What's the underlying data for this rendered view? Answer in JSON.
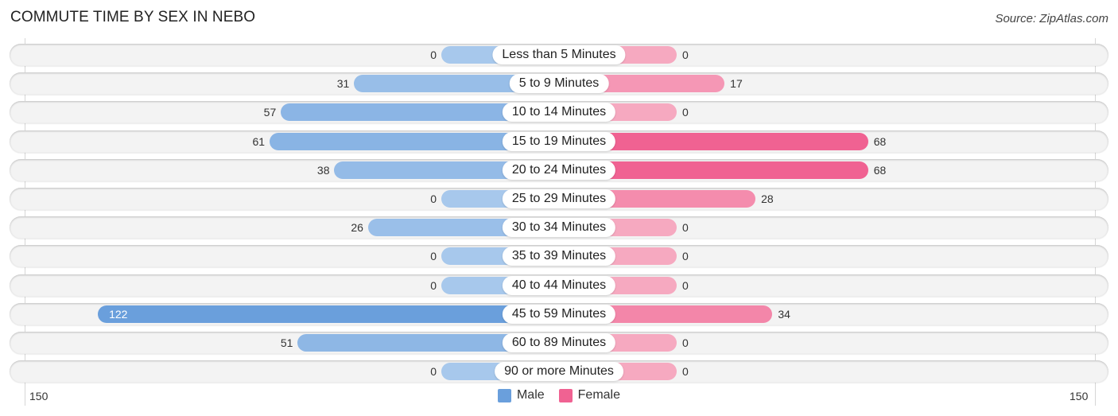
{
  "title": "COMMUTE TIME BY SEX IN NEBO",
  "source": "Source: ZipAtlas.com",
  "colors": {
    "male": "#6a9fdc",
    "male_light": "#a7c8ec",
    "female": "#f06292",
    "female_light": "#f6a9c0"
  },
  "legend": [
    {
      "label": "Male",
      "color": "#6a9fdc"
    },
    {
      "label": "Female",
      "color": "#f06292"
    }
  ],
  "axis": {
    "left_label": "150",
    "right_label": "150"
  },
  "chart_data": {
    "type": "bar",
    "orientation": "horizontal-diverging",
    "title": "COMMUTE TIME BY SEX IN NEBO",
    "categories": [
      "Less than 5 Minutes",
      "5 to 9 Minutes",
      "10 to 14 Minutes",
      "15 to 19 Minutes",
      "20 to 24 Minutes",
      "25 to 29 Minutes",
      "30 to 34 Minutes",
      "35 to 39 Minutes",
      "40 to 44 Minutes",
      "45 to 59 Minutes",
      "60 to 89 Minutes",
      "90 or more Minutes"
    ],
    "series": [
      {
        "name": "Male",
        "values": [
          0,
          31,
          57,
          61,
          38,
          0,
          26,
          0,
          0,
          122,
          51,
          0
        ]
      },
      {
        "name": "Female",
        "values": [
          0,
          17,
          0,
          68,
          68,
          28,
          0,
          0,
          0,
          34,
          0,
          0
        ]
      }
    ],
    "xlim": [
      -150,
      150
    ],
    "tick_labels": [
      "150",
      "150"
    ],
    "legend_position": "bottom-center",
    "grid": false
  }
}
